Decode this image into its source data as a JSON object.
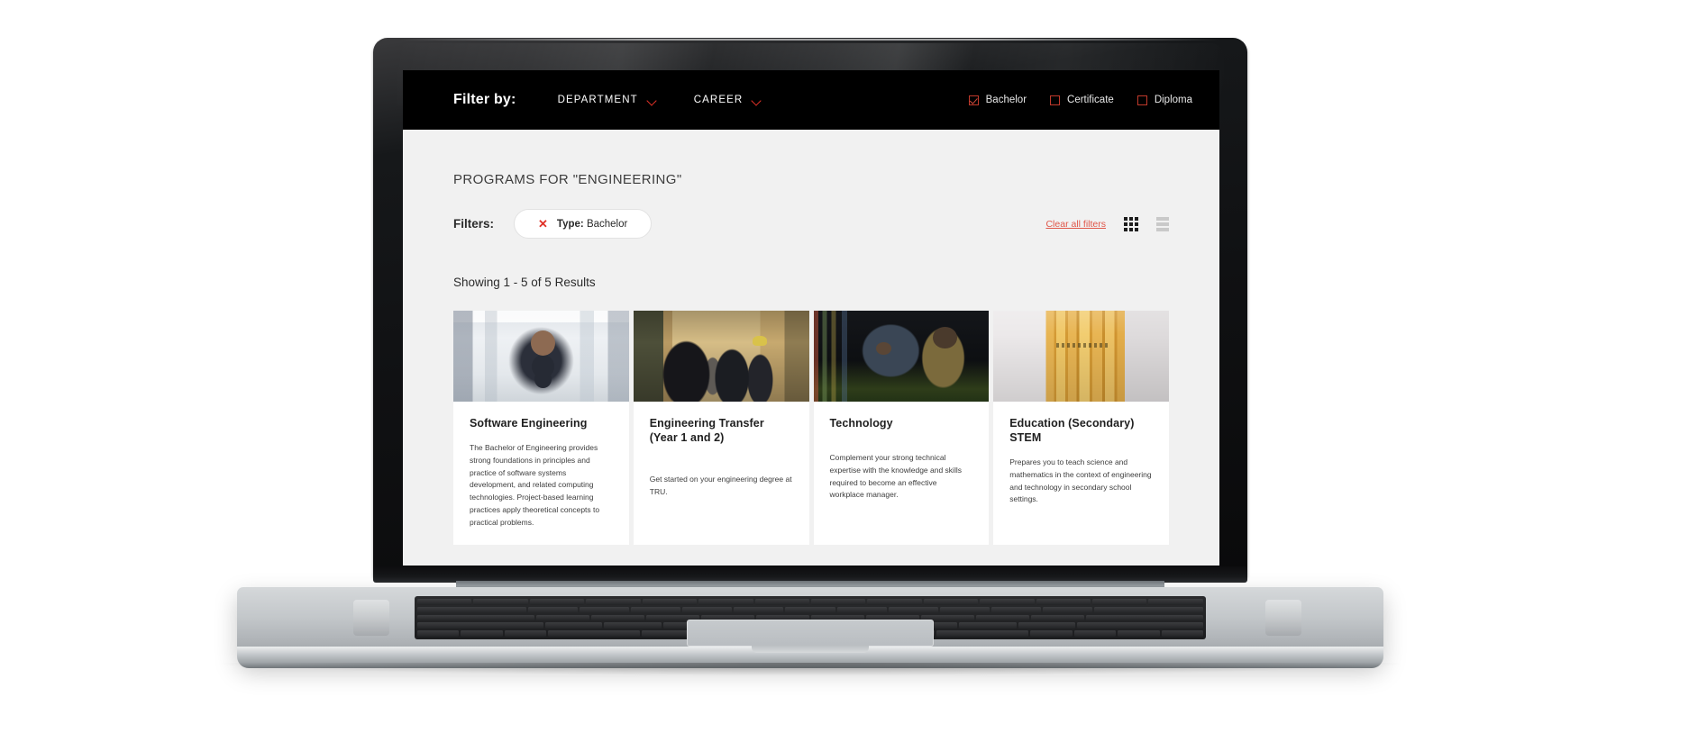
{
  "header": {
    "filter_by_label": "Filter by:",
    "dropdowns": [
      {
        "label": "DEPARTMENT",
        "icon": "chevron-down-icon"
      },
      {
        "label": "CAREER",
        "icon": "chevron-down-icon"
      }
    ],
    "type_filters": [
      {
        "label": "Bachelor",
        "checked": true
      },
      {
        "label": "Certificate",
        "checked": false
      },
      {
        "label": "Diploma",
        "checked": false
      }
    ],
    "background_color": "#000000",
    "accent_color": "#e03127"
  },
  "main": {
    "results_heading": "PROGRAMS FOR \"ENGINEERING\"",
    "filters_label": "Filters:",
    "active_filter_chip": {
      "remove_icon": "close-icon",
      "key": "Type:",
      "value": " Bachelor"
    },
    "clear_all_filters": "Clear all filters",
    "view_toggle": {
      "grid_icon": "grid-view-icon",
      "list_icon": "list-view-icon",
      "active": "grid"
    },
    "showing_results": "Showing 1 - 5 of 5 Results",
    "cards": [
      {
        "image_name": "img-software-engineering",
        "title": "Software Engineering",
        "description": "The Bachelor of Engineering provides strong foundations in principles and practice of software systems development, and related computing technologies. Project-based learning practices apply theoretical concepts to practical problems."
      },
      {
        "image_name": "img-engineering-transfer",
        "title": "Engineering Transfer (Year 1 and 2)",
        "description": "Get started on your engineering degree at TRU."
      },
      {
        "image_name": "img-technology",
        "title": "Technology",
        "description": "Complement your strong technical expertise with the knowledge and skills required to become an effective workplace manager."
      },
      {
        "image_name": "img-education-stem",
        "title": "Education (Secondary) STEM",
        "description": "Prepares you to teach science and mathematics in the context of engineering and technology in secondary school settings."
      }
    ]
  }
}
